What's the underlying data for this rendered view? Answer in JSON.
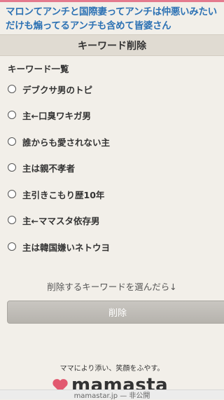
{
  "page": {
    "title": "マロンてアンチと国際妻ってアンチは仲悪いみたいだけも煽ってるアンチも含めて皆婆さん",
    "header": "キーワード削除"
  },
  "keywords": {
    "label": "キーワード一覧",
    "items": [
      {
        "label": "デブクサ男のトピ",
        "selected": false
      },
      {
        "label": "主←口臭ワキガ男",
        "selected": false
      },
      {
        "label": "誰からも愛されない主",
        "selected": false
      },
      {
        "label": "主は親不孝者",
        "selected": false
      },
      {
        "label": "主引きこもり歴10年",
        "selected": false
      },
      {
        "label": "主←ママスタ依存男",
        "selected": false
      },
      {
        "label": "主は韓国嫌いネトウヨ",
        "selected": false
      }
    ]
  },
  "instruction": "削除するキーワードを選んだら↓",
  "delete_button": "削除",
  "footer": {
    "tagline": "ママにより添い、笑顔をふやす。",
    "logo_text": "mamasta",
    "url": "mamastar.jp — 非公開"
  },
  "colors": {
    "title": "#2d72b4",
    "accent_strip": "#e47a8e",
    "logo_heart": "#e2596f"
  }
}
